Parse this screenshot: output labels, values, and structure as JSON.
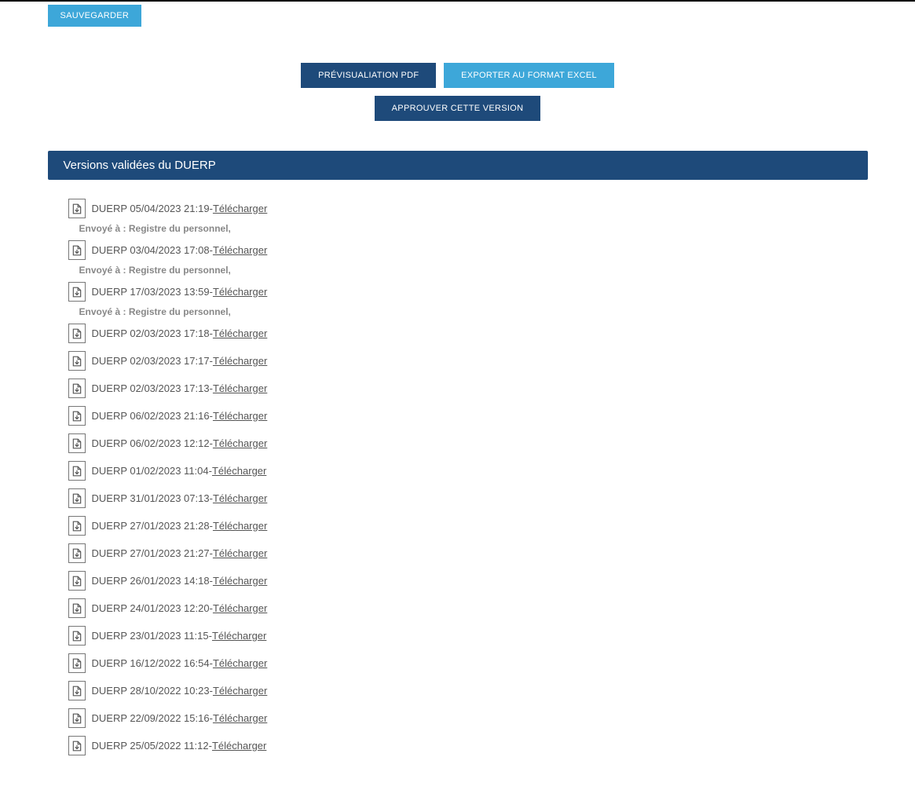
{
  "buttons": {
    "save": "SAUVEGARDER",
    "preview_pdf": "PRÉVISUALIATION PDF",
    "export_excel": "EXPORTER AU FORMAT EXCEL",
    "approve": "APPROUVER CETTE VERSION"
  },
  "section_title": "Versions validées du DUERP",
  "download_label": "Télécharger",
  "sent_to_prefix": "Envoyé à : ",
  "versions": [
    {
      "label": "DUERP 05/04/2023 21:19",
      "sent_to": "Registre du personnel,"
    },
    {
      "label": "DUERP 03/04/2023 17:08",
      "sent_to": "Registre du personnel,"
    },
    {
      "label": "DUERP 17/03/2023 13:59",
      "sent_to": "Registre du personnel,"
    },
    {
      "label": "DUERP 02/03/2023 17:18"
    },
    {
      "label": "DUERP 02/03/2023 17:17"
    },
    {
      "label": "DUERP 02/03/2023 17:13"
    },
    {
      "label": "DUERP 06/02/2023 21:16"
    },
    {
      "label": "DUERP 06/02/2023 12:12"
    },
    {
      "label": "DUERP 01/02/2023 11:04"
    },
    {
      "label": "DUERP 31/01/2023 07:13"
    },
    {
      "label": "DUERP 27/01/2023 21:28"
    },
    {
      "label": "DUERP 27/01/2023 21:27"
    },
    {
      "label": "DUERP 26/01/2023 14:18"
    },
    {
      "label": "DUERP 24/01/2023 12:20"
    },
    {
      "label": "DUERP 23/01/2023 11:15"
    },
    {
      "label": "DUERP 16/12/2022 16:54"
    },
    {
      "label": "DUERP 28/10/2022 10:23"
    },
    {
      "label": "DUERP 22/09/2022 15:16"
    },
    {
      "label": "DUERP 25/05/2022 11:12"
    }
  ]
}
